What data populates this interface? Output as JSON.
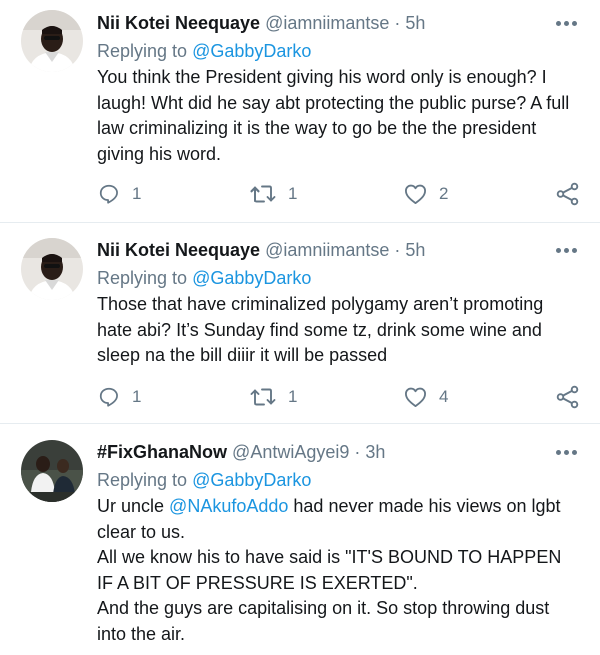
{
  "tweets": [
    {
      "author_name": "Nii Kotei Neequaye",
      "handle": "@iamniimantse",
      "separator": "·",
      "time": "5h",
      "replying_label": "Replying to",
      "replying_to": "@GabbyDarko",
      "avatar_icon": "avatar-man-icon",
      "body": [
        "You think the President giving his word only is enough? I laugh! Wht did he say abt protecting the public purse? A full law criminalizing it is the way to go be the the president giving his word."
      ],
      "reply_count": "1",
      "retweet_count": "1",
      "like_count": "2"
    },
    {
      "author_name": "Nii Kotei Neequaye",
      "handle": "@iamniimantse",
      "separator": "·",
      "time": "5h",
      "replying_label": "Replying to",
      "replying_to": "@GabbyDarko",
      "avatar_icon": "avatar-man-icon",
      "body": [
        "Those that have criminalized polygamy aren’t promoting hate abi?  It’s Sunday find some tz, drink some wine and sleep na the bill diiir it will be passed"
      ],
      "reply_count": "1",
      "retweet_count": "1",
      "like_count": "4"
    },
    {
      "author_name": "#FixGhanaNow",
      "handle": "@AntwiAgyei9",
      "separator": "·",
      "time": "3h",
      "replying_label": "Replying to",
      "replying_to": "@GabbyDarko",
      "avatar_icon": "avatar-group-icon",
      "body_prefix": "Ur uncle",
      "body_mention": "@NAkufoAddo",
      "body_suffix": "had never made his views on lgbt clear to us.",
      "body_line2": "All we know his to have said is \"IT'S BOUND TO HAPPEN IF A BIT OF PRESSURE IS EXERTED\".",
      "body_line3": "And the guys are capitalising on it. So stop throwing dust into the air."
    }
  ],
  "icons": {
    "reply": "reply-icon",
    "retweet": "retweet-icon",
    "like": "heart-icon",
    "share": "share-icon",
    "more": "more-options-icon"
  },
  "colors": {
    "text_primary": "#14171a",
    "text_secondary": "#657786",
    "link": "#1b95e0",
    "divider": "#e6ecf0"
  }
}
